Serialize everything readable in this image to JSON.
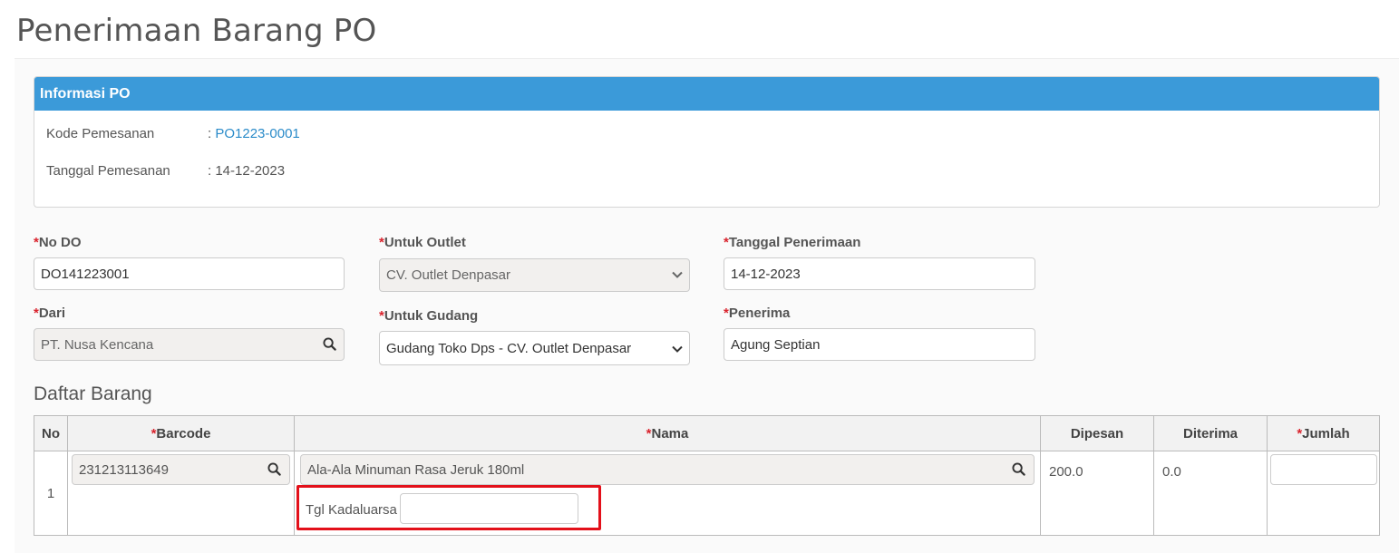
{
  "page_title": "Penerimaan Barang PO",
  "info_panel": {
    "title": "Informasi PO",
    "order_code_label": "Kode Pemesanan",
    "order_code_value": "PO1223-0001",
    "order_date_label": "Tanggal Pemesanan",
    "order_date_value": "14-12-2023",
    "separator": ":"
  },
  "form": {
    "required_mark": "*",
    "no_do_label": "No DO",
    "no_do_value": "DO141223001",
    "outlet_label": "Untuk Outlet",
    "outlet_value": "CV. Outlet Denpasar",
    "receive_date_label": "Tanggal Penerimaan",
    "receive_date_value": "14-12-2023",
    "from_label": "Dari",
    "from_value": "PT. Nusa Kencana",
    "warehouse_label": "Untuk Gudang",
    "warehouse_value": "Gudang Toko Dps - CV. Outlet Denpasar",
    "receiver_label": "Penerima",
    "receiver_value": "Agung Septian"
  },
  "items_section": {
    "title": "Daftar Barang",
    "columns": {
      "no": "No",
      "barcode": "Barcode",
      "name": "Nama",
      "ordered": "Dipesan",
      "received": "Diterima",
      "qty": "Jumlah"
    },
    "rows": [
      {
        "no": "1",
        "barcode": "231213113649",
        "name": "Ala-Ala Minuman Rasa Jeruk 180ml",
        "expiry_label": "Tgl Kadaluarsa",
        "expiry_value": "",
        "ordered": "200.0",
        "received": "0.0",
        "qty": ""
      }
    ]
  },
  "colors": {
    "panel_header": "#3b9ad9",
    "required": "#d9232d",
    "link": "#2a8bc9",
    "highlight": "#e3101a"
  },
  "icons": [
    "search-icon",
    "chevron-down-icon"
  ]
}
